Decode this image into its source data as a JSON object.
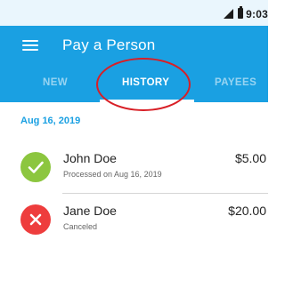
{
  "status_bar": {
    "time": "9:03",
    "icons": [
      "signal-icon",
      "battery-icon"
    ]
  },
  "app_bar": {
    "menu_icon": "hamburger-menu-icon",
    "title": "Pay a Person"
  },
  "tabs": [
    {
      "label": "NEW",
      "active": false
    },
    {
      "label": "HISTORY",
      "active": true
    },
    {
      "label": "PAYEES",
      "active": false
    }
  ],
  "annotation": {
    "type": "circle",
    "target": "HISTORY",
    "color": "#d81f26"
  },
  "history": {
    "section_date": "Aug 16, 2019",
    "items": [
      {
        "name": "John Doe",
        "status": "Processed on Aug 16, 2019",
        "amount": "$5.00",
        "icon": "checkmark-icon",
        "color": "#8cc63f"
      },
      {
        "name": "Jane Doe",
        "status": "Canceled",
        "amount": "$20.00",
        "icon": "x-icon",
        "color": "#ee3d3d"
      }
    ]
  },
  "colors": {
    "primary": "#1aa0e2",
    "status_bar": "#eaf6fd",
    "success": "#8cc63f",
    "error": "#ee3d3d"
  }
}
